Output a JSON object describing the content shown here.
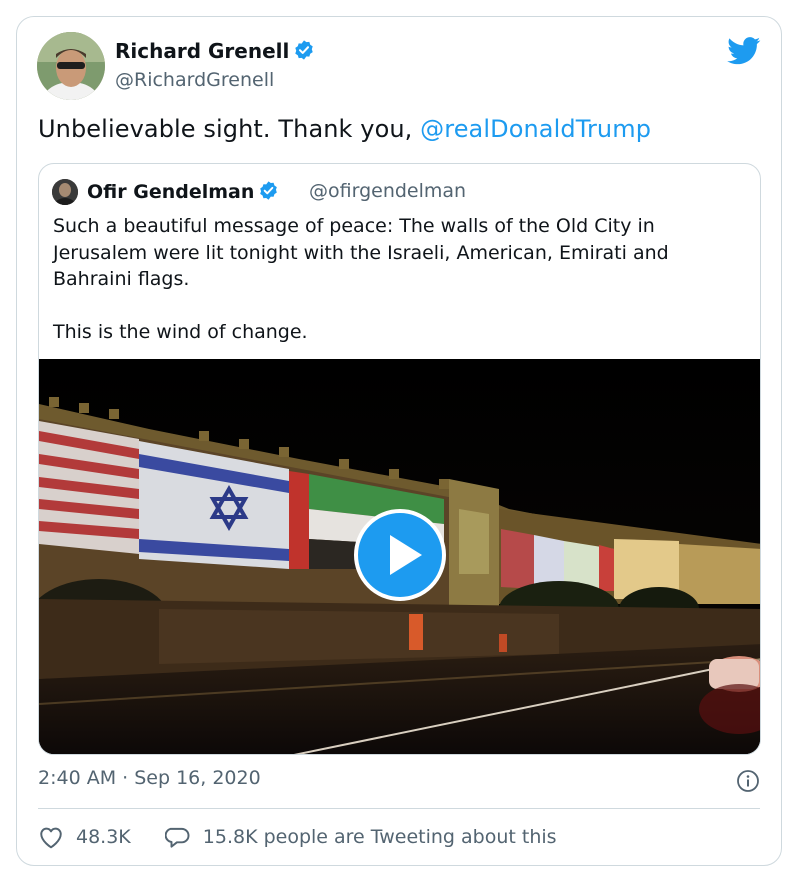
{
  "tweet": {
    "author": {
      "name": "Richard Grenell",
      "handle": "@RichardGrenell"
    },
    "text": "Unbelievable sight. Thank you, ",
    "mention": "@realDonaldTrump",
    "timestamp": "2:40 AM · Sep 16, 2020"
  },
  "quoted_tweet": {
    "author": {
      "name": "Ofir Gendelman",
      "handle": "@ofirgendelman"
    },
    "paragraphs": [
      "Such a beautiful message of peace: The walls of the Old City in Jerusalem were lit tonight with the Israeli, American, Emirati and Bahraini flags.",
      "This is the wind of change."
    ],
    "media": {
      "type": "video",
      "icon": "play-icon"
    }
  },
  "actions": {
    "likes": "48.3K",
    "conversation": "15.8K people are Tweeting about this"
  },
  "colors": {
    "accent": "#1d9bf0",
    "text": "#0f1419",
    "muted": "#536471",
    "border": "#cfd9de"
  }
}
